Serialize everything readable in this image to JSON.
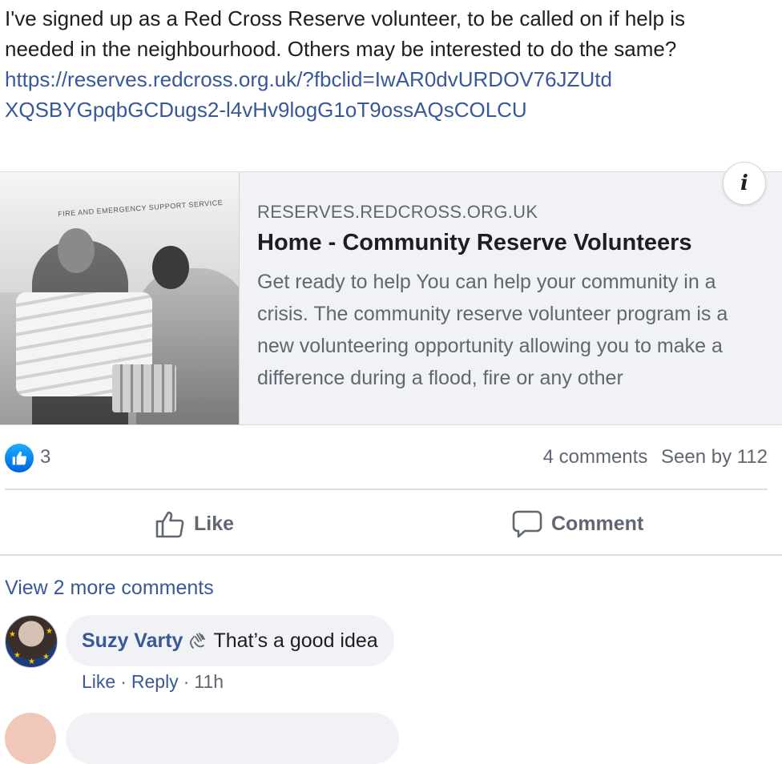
{
  "post": {
    "text": "I've signed up as a Red Cross Reserve volunteer, to be called on if help is needed in the neighbourhood. Others may be interested to do the same?",
    "link": "https://reserves.redcross.org.uk/?fbclid=IwAR0dvURDOV76JZUtdXQSBYGpqbGCDugs2-l4vHv9logG1oT9ossAQsCOLCU"
  },
  "link_card": {
    "image_caption_text": "FIRE AND EMERGENCY SUPPORT SERVICE",
    "info_label": "i",
    "domain": "RESERVES.REDCROSS.ORG.UK",
    "title": "Home - Community Reserve Volunteers",
    "description": "Get ready to help You can help your community in a crisis. The community reserve volunteer program is a new volunteering opportunity allowing you to make a difference during a flood, fire or any other"
  },
  "reactions": {
    "like_count": "3",
    "comments_text": "4 comments",
    "seen_text": "Seen by 112"
  },
  "actions": {
    "like_label": "Like",
    "comment_label": "Comment"
  },
  "comments": {
    "view_more_label": "View 2 more comments",
    "items": [
      {
        "author": "Suzy Varty",
        "body": "That’s a good idea",
        "like_label": "Like",
        "reply_label": "Reply",
        "time": "11h"
      }
    ]
  },
  "colors": {
    "link_blue": "#385898",
    "like_blue": "#1877f2",
    "muted_gray": "#606770",
    "card_bg": "#f0f2f5"
  },
  "icons": [
    "info-icon",
    "like-reaction-icon",
    "thumbs-up-icon",
    "comment-icon",
    "wave-badge-icon"
  ]
}
